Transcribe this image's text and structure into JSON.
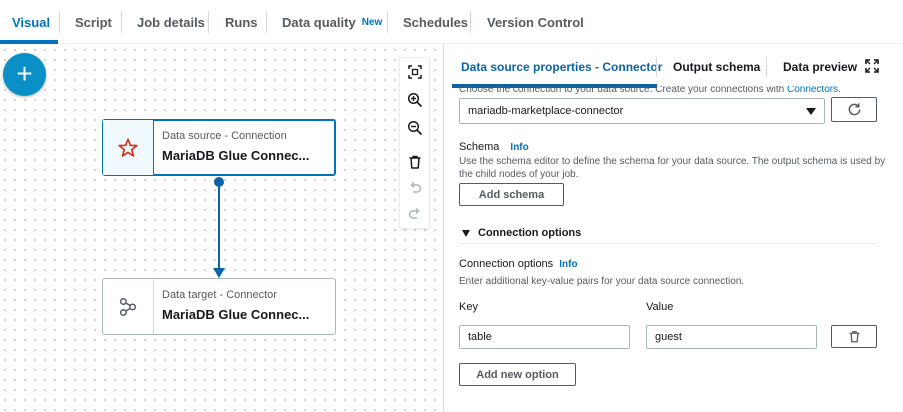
{
  "tabs": [
    {
      "label": "Visual",
      "active": true
    },
    {
      "label": "Script"
    },
    {
      "label": "Job details"
    },
    {
      "label": "Runs"
    },
    {
      "label": "Data quality",
      "badge": "New"
    },
    {
      "label": "Schedules"
    },
    {
      "label": "Version Control"
    }
  ],
  "canvas": {
    "add_button": "+",
    "source_node": {
      "type": "Data source - Connection",
      "name": "MariaDB Glue Connec..."
    },
    "target_node": {
      "type": "Data target - Connector",
      "name": "MariaDB Glue Connec..."
    },
    "toolbar_icons": [
      "fit-to-screen-icon",
      "zoom-in-icon",
      "zoom-out-icon",
      "delete-icon",
      "undo-icon",
      "redo-icon"
    ]
  },
  "panel": {
    "tabs": [
      "Data source properties - Connector",
      "Output schema",
      "Data preview"
    ],
    "expand_icon": "expand-icon",
    "cutoff_text": "Choose the connection to your data source. Create your connections with ",
    "cutoff_link": "Connectors.",
    "connection_select": "mariadb-marketplace-connector",
    "schema": {
      "label": "Schema",
      "info": "Info",
      "description": "Use the schema editor to define the schema for your data source. The output schema is used by the child nodes of your job.",
      "button": "Add schema"
    },
    "connection_options_section": "Connection options",
    "connection_options": {
      "label": "Connection options",
      "info": "Info",
      "description": "Enter additional key-value pairs for your data source connection.",
      "key_label": "Key",
      "value_label": "Value",
      "key_value": "table",
      "value_value": "guest",
      "add_button": "Add new option"
    }
  },
  "colors": {
    "accent": "#0073bb",
    "fab": "#0a8fc7",
    "edge": "#0a64a8"
  }
}
